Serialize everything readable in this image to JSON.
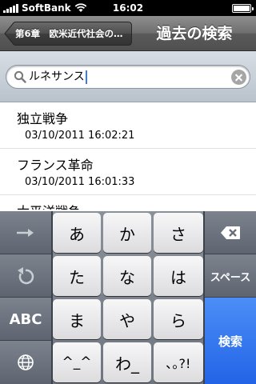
{
  "status_bar": {
    "carrier": "SoftBank",
    "time": "16:02",
    "battery_level": 1.0
  },
  "nav": {
    "back_label": "第6章　欧米近代社会の…",
    "title": "過去の検索"
  },
  "search": {
    "value": "ルネサンス"
  },
  "results": [
    {
      "title": "独立戦争",
      "timestamp": "03/10/2011 16:02:21"
    },
    {
      "title": "フランス革命",
      "timestamp": "03/10/2011 16:01:33"
    },
    {
      "title": "太平洋戦争",
      "timestamp": ""
    }
  ],
  "keyboard": {
    "keys": {
      "a": "あ",
      "ka": "か",
      "sa": "さ",
      "ta": "た",
      "na": "な",
      "ha": "は",
      "ma": "ま",
      "ya": "や",
      "ra": "ら",
      "dakuten": "^_^",
      "wa": "わ_",
      "punct": "､｡?!"
    },
    "abc_label": "ABC",
    "space_label": "スペース",
    "search_label": "検索"
  }
}
